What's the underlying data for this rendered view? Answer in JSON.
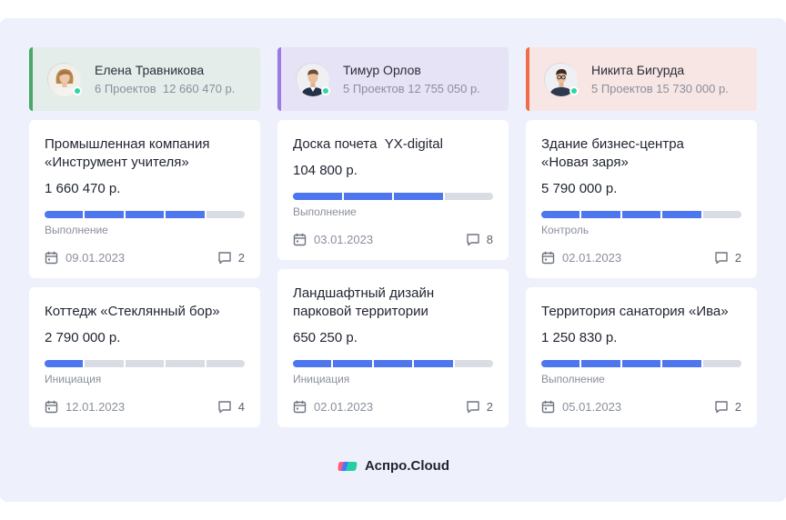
{
  "columns": [
    {
      "name": "Елена Травникова",
      "meta": "6 Проектов  12 660 470 р.",
      "accent": "#4aa769",
      "avatar": "woman-avatar-icon",
      "cards": [
        {
          "title_lines": [
            "Промышленная компания",
            "«Инструмент учителя»"
          ],
          "amount": "1 660 470 р.",
          "progress": 4,
          "progress_total": 5,
          "stage": "Выполнение",
          "date": "09.01.2023",
          "comments": "2"
        },
        {
          "title_lines": [
            "Коттедж «Стеклянный бор»"
          ],
          "amount": "2 790 000 р.",
          "progress": 1,
          "progress_total": 5,
          "stage": "Инициация",
          "date": "12.01.2023",
          "comments": "4"
        }
      ]
    },
    {
      "name": "Тимур Орлов",
      "meta": "5 Проектов 12 755 050 р.",
      "accent": "#9a7ae6",
      "avatar": "man-avatar-icon",
      "cards": [
        {
          "title_lines": [
            "Доска почета  YX-digital"
          ],
          "amount": "104 800 р.",
          "progress": 3,
          "progress_total": 4,
          "stage": "Выполнение",
          "date": "03.01.2023",
          "comments": "8"
        },
        {
          "title_lines": [
            "Ландшафтный дизайн",
            "парковой территории"
          ],
          "amount": "650 250 р.",
          "progress": 4,
          "progress_total": 5,
          "stage": "Инициация",
          "date": "02.01.2023",
          "comments": "2"
        }
      ]
    },
    {
      "name": "Никита Бигурда",
      "meta": "5 Проектов 15 730 000 р.",
      "accent": "#f06d4a",
      "avatar": "man-glasses-avatar-icon",
      "cards": [
        {
          "title_lines": [
            "Здание бизнес-центра",
            "«Новая заря»"
          ],
          "amount": "5 790 000 р.",
          "progress": 4,
          "progress_total": 5,
          "stage": "Контроль",
          "date": "02.01.2023",
          "comments": "2"
        },
        {
          "title_lines": [
            "Территория санатория «Ива»"
          ],
          "amount": "1 250 830 р.",
          "progress": 4,
          "progress_total": 5,
          "stage": "Выполнение",
          "date": "05.01.2023",
          "comments": "2"
        }
      ]
    }
  ],
  "colors": {
    "progress_on": "#4e76ee",
    "progress_off": "#d8dce3",
    "online": "#2fd6a4"
  },
  "brand": {
    "name": "Аспро.Cloud",
    "logo": "aspro-cloud-logo-icon"
  }
}
